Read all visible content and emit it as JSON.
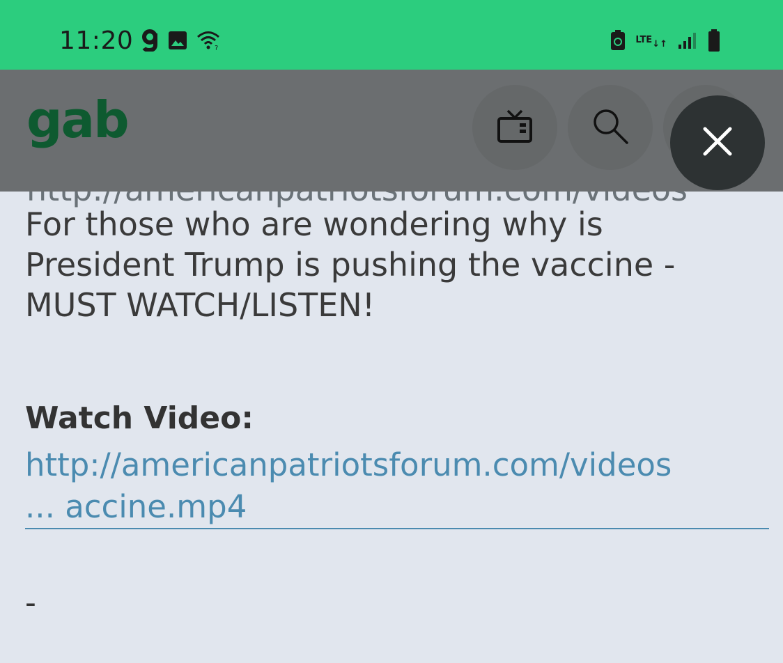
{
  "status_bar": {
    "time": "11:20",
    "network_label": "LTE"
  },
  "header": {
    "logo_text": "gab",
    "icons": [
      "tv-icon",
      "search-icon",
      "close-icon"
    ]
  },
  "post": {
    "overflow_url": "http://americanpatriotsforum.com/videos",
    "body_lines": [
      "For those who are wondering why is",
      "President Trump is pushing the vaccine -",
      "MUST WATCH/LISTEN!"
    ],
    "watch_heading": "Watch Video:",
    "link_line1": "http://americanpatriotsforum.com/videos",
    "link_line2": "... accine.mp4",
    "separator": "-"
  },
  "colors": {
    "status_bar": "#2ccd7e",
    "header_overlay": "#6b6e70",
    "logo": "#0e5a30",
    "link": "#4b8bb0",
    "background": "#e1e6ee"
  }
}
